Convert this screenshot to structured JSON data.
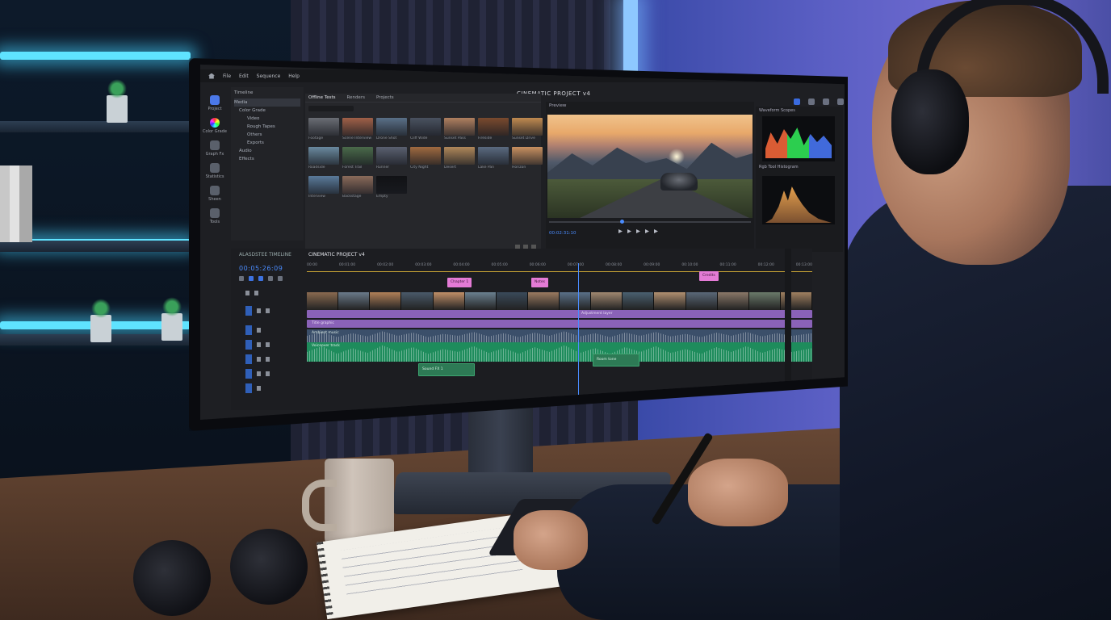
{
  "app": {
    "menu": [
      "File",
      "Edit",
      "Sequence",
      "Help"
    ],
    "project_title": "CINEMATIC PROJECT v4"
  },
  "rail": {
    "items": [
      {
        "label": "Project",
        "icon": "folder-icon"
      },
      {
        "label": "Color Grade",
        "icon": "color-wheel-icon"
      },
      {
        "label": "Graph Fx",
        "icon": "graph-icon"
      },
      {
        "label": "Statistics",
        "icon": "stats-icon"
      },
      {
        "label": "Sheen",
        "icon": "brush-icon"
      },
      {
        "label": "Tools",
        "icon": "tools-icon"
      }
    ]
  },
  "tree": {
    "header": "Timeline",
    "rows": [
      "Media",
      "Color Grade",
      "Video",
      "Rough Tapes",
      "Others",
      "Exports",
      "Audio",
      "Effects"
    ]
  },
  "bin": {
    "tabs": [
      "Offline Tests",
      "Renders",
      "Projects"
    ],
    "thumbs": [
      {
        "caption": "Footage",
        "color": "#6a6d74"
      },
      {
        "caption": "Scene Interview",
        "color": "#a06048"
      },
      {
        "caption": "Drone Shot",
        "color": "#5a7088"
      },
      {
        "caption": "Cliff Wide",
        "color": "#4a5260"
      },
      {
        "caption": "Sunset Pass",
        "color": "#b08060"
      },
      {
        "caption": "Fireside",
        "color": "#7a4a2e"
      },
      {
        "caption": "Sunset Drive",
        "color": "#c08a50"
      },
      {
        "caption": "Roadside",
        "color": "#6a8aa0"
      },
      {
        "caption": "Forest Trail",
        "color": "#4a6a4a"
      },
      {
        "caption": "Runner",
        "color": "#5a6070"
      },
      {
        "caption": "City Night",
        "color": "#a06a40"
      },
      {
        "caption": "Desert",
        "color": "#b0885a"
      },
      {
        "caption": "Lake Pan",
        "color": "#5a6a80"
      },
      {
        "caption": "Horizon",
        "color": "#c89060"
      },
      {
        "caption": "Interview",
        "color": "#5a7a9a"
      },
      {
        "caption": "Backstage",
        "color": "#8a6a5a"
      },
      {
        "caption": "Empty",
        "color": "#111215"
      }
    ]
  },
  "preview": {
    "label": "Preview",
    "timecode": "00:02:31:10"
  },
  "scopes": {
    "waveform_label": "Waveform Scopes",
    "histogram_label": "Rgb Tool Histogram"
  },
  "timeline": {
    "panel_label": "ALASDSTEE TIMELINE",
    "tab_label": "CINEMATIC PROJECT v4",
    "timecode": "00:05:26:09",
    "ruler": [
      "00:00",
      "00:01:00",
      "00:02:00",
      "00:03:00",
      "00:04:00",
      "00:05:00",
      "00:06:00",
      "00:07:00",
      "00:08:00",
      "00:09:00",
      "00:10:00",
      "00:11:00",
      "00:12:00",
      "00:13:00"
    ],
    "markers": [
      {
        "label": "Chapter 1"
      },
      {
        "label": "Notes"
      },
      {
        "label": "Credits"
      }
    ],
    "purple_bands": [
      "Title graphic",
      "Adjustment layer"
    ],
    "audio_tracks": [
      "Ambient music",
      "Voiceover track",
      "Dialogue mix"
    ],
    "sub_clips": [
      "Sound FX 1",
      "Room tone"
    ]
  }
}
